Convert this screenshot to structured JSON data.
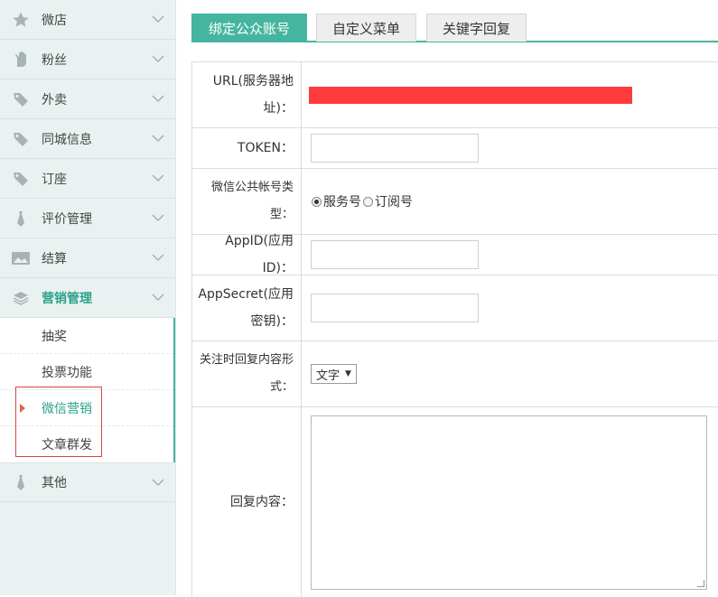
{
  "sidebar": {
    "items": [
      {
        "label": "微店",
        "icon": "star-icon"
      },
      {
        "label": "粉丝",
        "icon": "hand-icon"
      },
      {
        "label": "外卖",
        "icon": "tag-icon"
      },
      {
        "label": "同城信息",
        "icon": "tag-icon"
      },
      {
        "label": "订座",
        "icon": "tag-icon"
      },
      {
        "label": "评价管理",
        "icon": "tie-icon"
      },
      {
        "label": "结算",
        "icon": "image-icon"
      },
      {
        "label": "营销管理",
        "icon": "layers-icon"
      }
    ],
    "sub_items": [
      {
        "label": "抽奖"
      },
      {
        "label": "投票功能"
      },
      {
        "label": "微信营销"
      },
      {
        "label": "文章群发"
      }
    ],
    "last_item": {
      "label": "其他",
      "icon": "tie-icon"
    }
  },
  "tabs": [
    {
      "label": "绑定公众账号"
    },
    {
      "label": "自定义菜单"
    },
    {
      "label": "关键字回复"
    }
  ],
  "form": {
    "url_label": "URL(服务器地址)：",
    "token_label": "TOKEN：",
    "token_value": "",
    "type_label": "微信公共帐号类型：",
    "type_options": [
      "服务号",
      "订阅号"
    ],
    "appid_label": "AppID(应用ID)：",
    "appid_value": "",
    "secret_label": "AppSecret(应用密钥)：",
    "secret_value": "",
    "reply_type_label": "关注时回复内容形式：",
    "reply_type_value": "文字",
    "reply_content_label": "回复内容：",
    "reply_content_value": ""
  },
  "colors": {
    "accent": "#46b59f",
    "redact": "#ff3b3b",
    "highlight_box": "#d64545"
  }
}
